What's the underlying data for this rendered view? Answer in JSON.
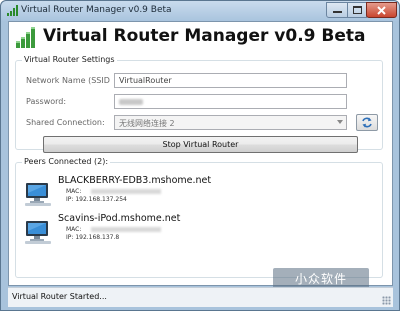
{
  "window": {
    "title": "Virtual Router Manager v0.9 Beta"
  },
  "header": {
    "app_title": "Virtual Router Manager v0.9 Beta"
  },
  "settings": {
    "legend": "Virtual Router Settings",
    "network_name_label": "Network Name (SSID):",
    "network_name_value": "VirtualRouter",
    "password_label": "Password:",
    "shared_connection_label": "Shared Connection:",
    "shared_connection_value": "无线网络连接 2"
  },
  "main_button": {
    "label": "Stop Virtual Router"
  },
  "peers": {
    "legend": "Peers Connected (2):",
    "items": [
      {
        "name": "BLACKBERRY-EDB3.mshome.net",
        "mac_label": "MAC:",
        "ip": "IP: 192.168.137.254"
      },
      {
        "name": "Scavins-iPod.mshome.net",
        "mac_label": "MAC:",
        "ip": "IP: 192.168.137.8"
      }
    ]
  },
  "watermark": {
    "text": "小众软件"
  },
  "status": {
    "text": "Virtual Router Started..."
  },
  "colors": {
    "accent": "#a8c3dc",
    "close_button": "#c9462f"
  }
}
